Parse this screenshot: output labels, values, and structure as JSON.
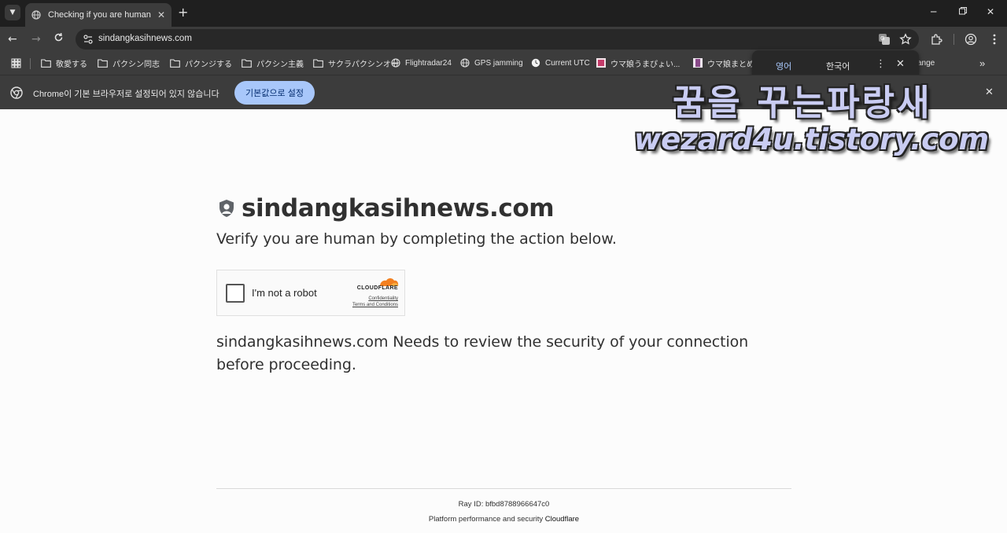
{
  "browser": {
    "tab": {
      "title": "Checking if you are human"
    },
    "url": "sindangkasihnews.com",
    "bookmarks": [
      {
        "label": "敬愛する",
        "icon": "folder-icon"
      },
      {
        "label": "パクシン同志",
        "icon": "folder-icon"
      },
      {
        "label": "パクンジする",
        "icon": "folder-icon"
      },
      {
        "label": "パクシン主義",
        "icon": "folder-icon"
      },
      {
        "label": "サクラパクシンオー",
        "icon": "folder-icon"
      },
      {
        "label": "Flightradar24",
        "icon": "globe-icon"
      },
      {
        "label": "GPS jamming",
        "icon": "globe-icon"
      },
      {
        "label": "Current UTC",
        "icon": "clock-icon"
      },
      {
        "label": "ウマ娘うまぴょい...",
        "icon": "site-favicon"
      },
      {
        "label": "ウマ娘まとめ",
        "icon": "site-favicon"
      },
      {
        "label": "ange",
        "icon": "site-favicon"
      }
    ],
    "infobar": {
      "text": "Chrome이 기본 브라우저로 설정되어 있지 않습니다",
      "button": "기본값으로 설정"
    },
    "translate": {
      "source_lang": "영어",
      "target_lang": "한국어"
    }
  },
  "page": {
    "site_title": "sindangkasihnews.com",
    "verify_text": "Verify you are human by completing the action below.",
    "challenge": {
      "checkbox_label": "I'm not a robot",
      "brand": "CLOUDFLARE",
      "link_privacy": "Confidentiality",
      "link_terms": "Terms and Conditions"
    },
    "review_text": "sindangkasihnews.com Needs to review the security of your connection before proceeding.",
    "footer": {
      "ray_id": "Ray ID: bfbd8788966647c0",
      "platform_prefix": "Platform performance and security",
      "platform_brand": "Cloudflare"
    }
  },
  "watermark": {
    "line1": "꿈을 꾸는파랑새",
    "line2": "wezard4u.tistory.com"
  },
  "colors": {
    "chrome_dark": "#1f1f1f",
    "chrome_bar": "#3c3c3c",
    "accent_blue": "#a8c7fa",
    "cloudflare_orange": "#f38020",
    "page_text": "#313131"
  }
}
